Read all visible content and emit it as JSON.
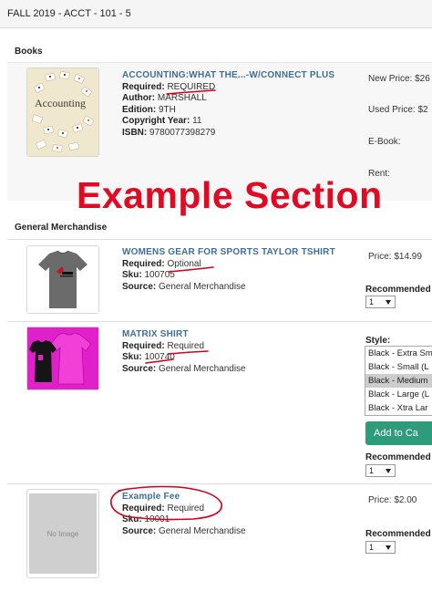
{
  "course": {
    "label": "FALL 2019 - ACCT - 101 - 5"
  },
  "overlay": {
    "banner": "Example Section"
  },
  "sections": {
    "books": {
      "title": "Books",
      "item": {
        "title": "ACCOUNTING:WHAT THE...-W/CONNECT PLUS",
        "required_label": "Required:",
        "required_value": "REQUIRED",
        "author_label": "Author:",
        "author_value": "MARSHALL",
        "edition_label": "Edition:",
        "edition_value": "9TH",
        "copyright_label": "Copyright Year:",
        "copyright_value": "11",
        "isbn_label": "ISBN:",
        "isbn_value": "9780077398279",
        "cover_text": "Accounting",
        "new_price": "New Price: $26",
        "used_price": "Used Price: $2",
        "ebook": "E-Book:",
        "rent": "Rent:"
      }
    },
    "merch": {
      "title": "General Merchandise",
      "items": [
        {
          "title": "WOMENS GEAR FOR SPORTS TAYLOR TSHIRT",
          "required_label": "Required:",
          "required_value": "Optional",
          "sku_label": "Sku:",
          "sku_value": "100705",
          "source_label": "Source:",
          "source_value": "General Merchandise",
          "price": "Price: $14.99",
          "recommended": "Recommended",
          "qty": "1"
        },
        {
          "title": "MATRIX SHIRT",
          "required_label": "Required:",
          "required_value": "Required",
          "sku_label": "Sku:",
          "sku_value": "100740",
          "source_label": "Source:",
          "source_value": "General Merchandise",
          "style_label": "Style:",
          "styles": [
            "Black - Extra Sm",
            "Black - Small (L",
            "Black - Medium",
            "Black - Large (L",
            "Black - Xtra Lar"
          ],
          "selected_style_index": 2,
          "add_to_cart": "Add to Ca",
          "recommended": "Recommended",
          "qty": "1"
        },
        {
          "title": "Example Fee",
          "required_label": "Required:",
          "required_value": "Required",
          "sku_label": "Sku:",
          "sku_value": "10001",
          "source_label": "Source:",
          "source_value": "General Merchandise",
          "no_image": "No Image",
          "price": "Price: $2.00",
          "recommended": "Recommended",
          "qty": "1"
        }
      ]
    }
  },
  "colors": {
    "link_title": "#3f6e97",
    "annotation_red": "#d3001c",
    "cart_green": "#2e9b7b",
    "tshirt_gray": "#6b6b6b",
    "matrix_magenta": "#e020c8"
  }
}
